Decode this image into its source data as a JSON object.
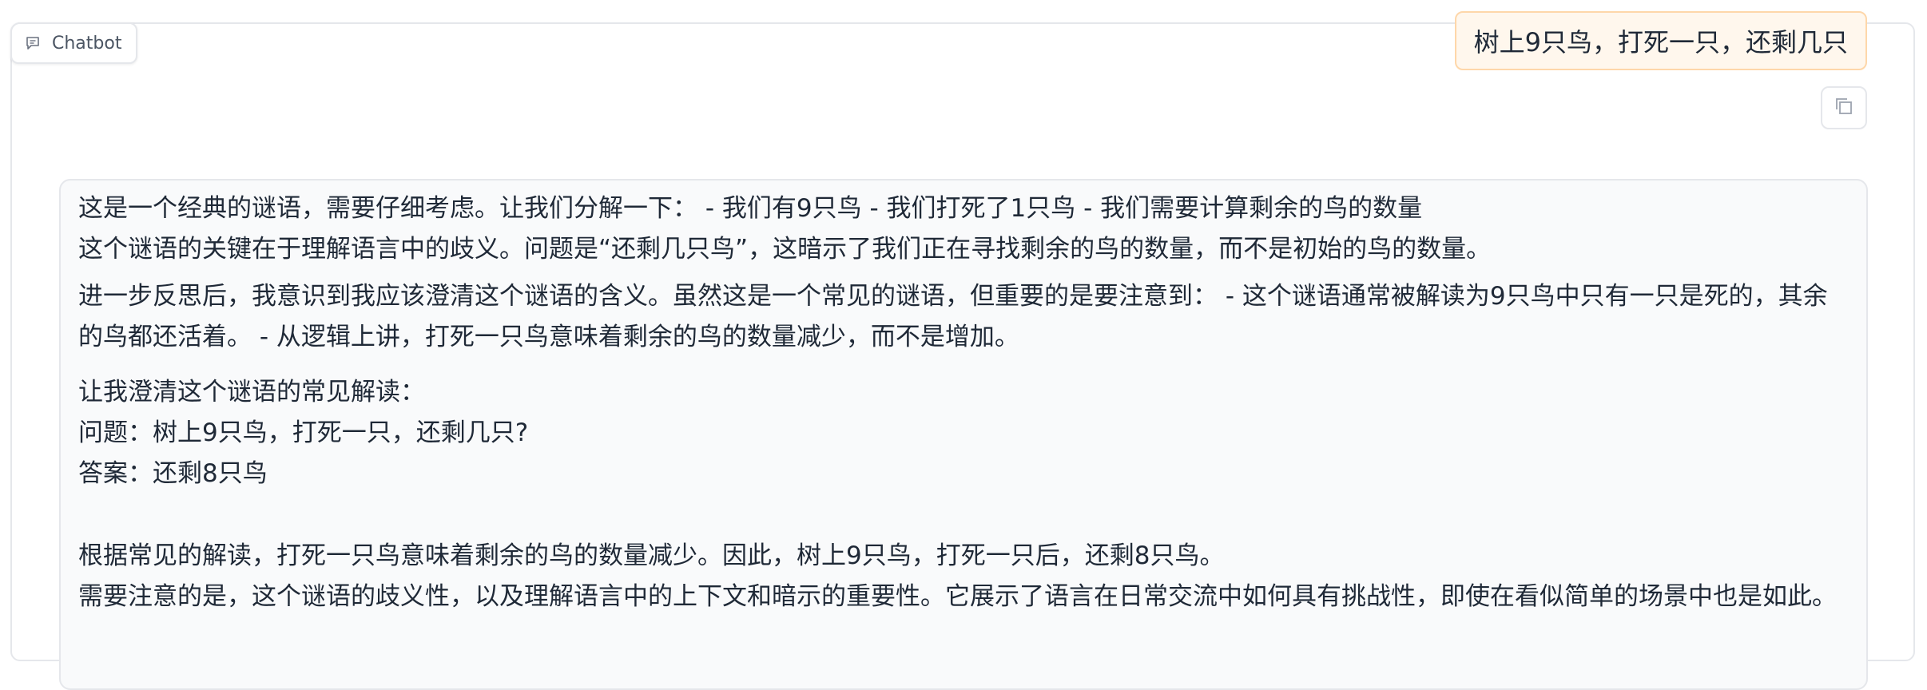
{
  "label": {
    "text": "Chatbot",
    "icon": "chat-bubble-icon"
  },
  "user_message": {
    "text": "树上9只鸟，打死一只，还剩几只"
  },
  "copy_button": {
    "icon": "copy-icon"
  },
  "bot_message": {
    "lines": [
      "这是一个经典的谜语，需要仔细考虑。让我们分解一下： - 我们有9只鸟 - 我们打死了1只鸟 - 我们需要计算剩余的鸟的数量",
      "这个谜语的关键在于理解语言中的歧义。问题是“还剩几只鸟”，这暗示了我们正在寻找剩余的鸟的数量，而不是初始的鸟的数量。",
      "进一步反思后，我意识到我应该澄清这个谜语的含义。虽然这是一个常见的谜语，但重要的是要注意到： - 这个谜语通常被解读为9只鸟中只有一只是死的，其余的鸟都还活着。 - 从逻辑上讲，打死一只鸟意味着剩余的鸟的数量减少，而不是增加。",
      "让我澄清这个谜语的常见解读：",
      "问题：树上9只鸟，打死一只，还剩几只?",
      "答案：还剩8只鸟",
      "根据常见的解读，打死一只鸟意味着剩余的鸟的数量减少。因此，树上9只鸟，打死一只后，还剩8只鸟。",
      "需要注意的是，这个谜语的歧义性，以及理解语言中的上下文和暗示的重要性。它展示了语言在日常交流中如何具有挑战性，即使在看似简单的场景中也是如此。"
    ]
  },
  "colors": {
    "user_bubble_bg": "#fff7ed",
    "user_bubble_border": "#fed7aa",
    "bot_bubble_bg": "#f9fafb",
    "border": "#e5e7eb"
  }
}
